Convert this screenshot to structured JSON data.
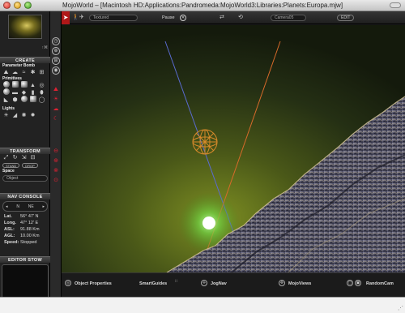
{
  "window": {
    "title": "MojoWorld – [Macintosh HD:Applications:Pandromeda:MojoWorld3:Libraries:Planets:Europa.mjw]"
  },
  "left_panel": {
    "thumbnail_tag": "↑⌘",
    "create": {
      "header": "CREATE",
      "parameter_bomb": "Parameter Bomb",
      "primitives": "Primitives",
      "lights": "Lights"
    },
    "transform": {
      "header": "TRANSFORM",
      "stand_label": "STAND",
      "drop_label": "DROP",
      "space_label": "Space",
      "space_value": "Object"
    },
    "nav_console": {
      "header": "NAV CONSOLE",
      "left_dir": "N",
      "right_dir": "NE",
      "readouts": [
        {
          "key": "Lat.",
          "value": "56° 47' N"
        },
        {
          "key": "Long.",
          "value": "47° 12' E"
        },
        {
          "key": "ASL:",
          "value": "91.88 Km"
        },
        {
          "key": "AGL:",
          "value": "10.00 Km"
        },
        {
          "key": "Speed:",
          "value": "Stopped"
        }
      ]
    },
    "editor_stow": {
      "header": "EDITOR STOW"
    }
  },
  "toolbar": {
    "render_mode": "Textured",
    "pause_label": "Pause",
    "camera": "Camera05",
    "edit_label": "EDIT"
  },
  "bottom_bar": {
    "object_properties": "Object Properties",
    "smart_guides": "SmartGuides",
    "jog_nav": "JogNav",
    "mojo_views": "MojoViews",
    "random_cam": "RandomCam"
  },
  "colors": {
    "accent_red": "#b01818",
    "sky_top": "#1c2410",
    "sky_glow": "#6b7a1c",
    "sun": "#ffffff",
    "wire_sphere": "#d88a2a",
    "axis_blue": "#5a6bd0",
    "axis_orange": "#d86a2a"
  }
}
